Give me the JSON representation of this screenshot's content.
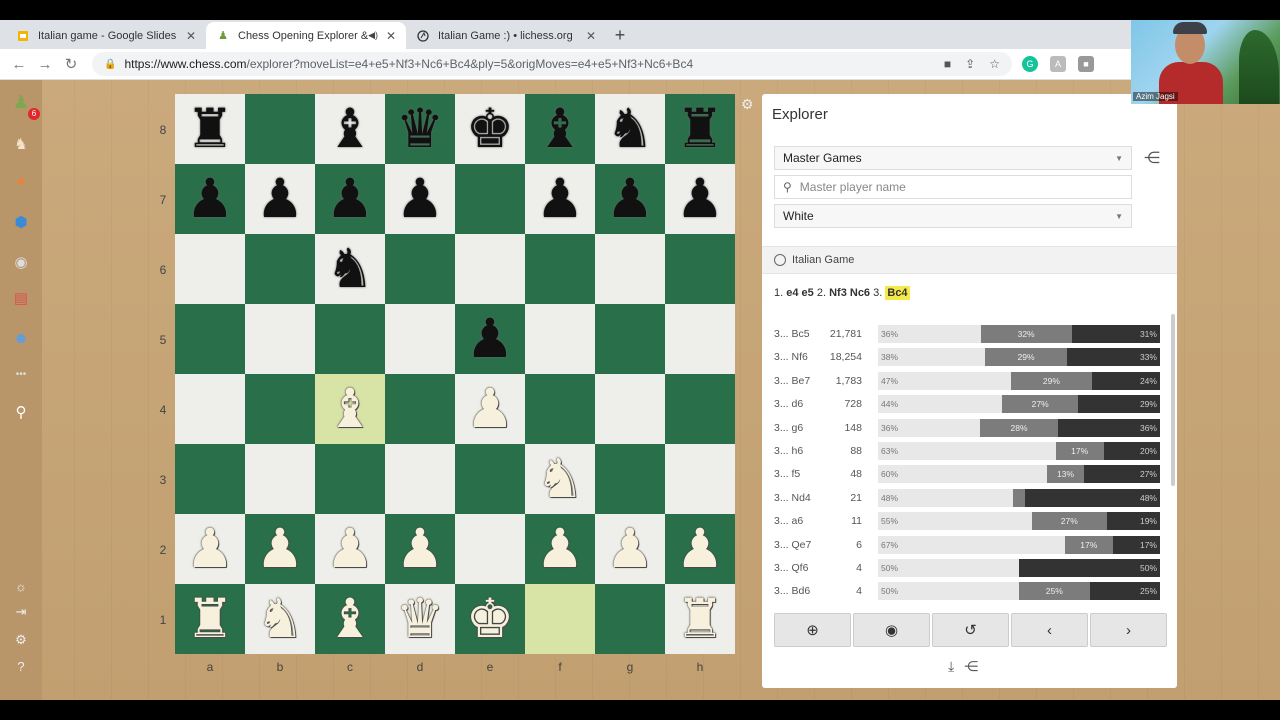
{
  "browser": {
    "tabs": [
      {
        "title": "Italian game - Google Slides",
        "icon": "slides-icon",
        "active": false
      },
      {
        "title": "Chess Opening Explorer & D",
        "icon": "chess-pawn-icon",
        "active": true
      },
      {
        "title": "Italian Game :) • lichess.org",
        "icon": "lichess-icon",
        "active": false
      }
    ],
    "url_host": "https://www.chess.com",
    "url_rest": "/explorer?moveList=e4+e5+Nf3+Nc6+Bc4&ply=5&origMoves=e4+e5+Nf3+Nc6+Bc4"
  },
  "sidebar": {
    "notification_count": "6",
    "icons": [
      "pawn-logo-icon",
      "play-icon",
      "puzzle-icon",
      "learn-icon",
      "watch-icon",
      "news-icon",
      "social-icon",
      "more-icon",
      "search-icon",
      "theme-icon",
      "collapse-icon",
      "settings-icon",
      "help-icon"
    ]
  },
  "board": {
    "ranks": [
      "8",
      "7",
      "6",
      "5",
      "4",
      "3",
      "2",
      "1"
    ],
    "files": [
      "a",
      "b",
      "c",
      "d",
      "e",
      "f",
      "g",
      "h"
    ],
    "pieces": [
      [
        "bR",
        "",
        "bB",
        "bQ",
        "bK",
        "bB",
        "bN",
        "bR"
      ],
      [
        "bP",
        "bP",
        "bP",
        "bP",
        "",
        "bP",
        "bP",
        "bP"
      ],
      [
        "",
        "",
        "bN",
        "",
        "",
        "",
        "",
        ""
      ],
      [
        "",
        "",
        "",
        "",
        "bP",
        "",
        "",
        ""
      ],
      [
        "",
        "",
        "wB",
        "",
        "wP",
        "",
        "",
        ""
      ],
      [
        "",
        "",
        "",
        "",
        "",
        "wN",
        "",
        ""
      ],
      [
        "wP",
        "wP",
        "wP",
        "wP",
        "",
        "wP",
        "wP",
        "wP"
      ],
      [
        "wR",
        "wN",
        "wB",
        "wQ",
        "wK",
        "",
        "",
        "wR"
      ]
    ],
    "last_move_squares": [
      "c4",
      "f1"
    ]
  },
  "explorer": {
    "title": "Explorer",
    "database": "Master Games",
    "player_placeholder": "Master player name",
    "color": "White",
    "opening_name": "Italian Game",
    "moves_line": [
      {
        "num": "1.",
        "moves": "e4 e5"
      },
      {
        "num": "2.",
        "moves": "Nf3 Nc6"
      },
      {
        "num": "3.",
        "moves": "Bc4"
      }
    ],
    "stats": [
      {
        "move": "3... Bc5",
        "games": "21,781",
        "white": 36,
        "draw": 32,
        "black": 31
      },
      {
        "move": "3... Nf6",
        "games": "18,254",
        "white": 38,
        "draw": 29,
        "black": 33
      },
      {
        "move": "3... Be7",
        "games": "1,783",
        "white": 47,
        "draw": 29,
        "black": 24
      },
      {
        "move": "3... d6",
        "games": "728",
        "white": 44,
        "draw": 27,
        "black": 29
      },
      {
        "move": "3... g6",
        "games": "148",
        "white": 36,
        "draw": 28,
        "black": 36
      },
      {
        "move": "3... h6",
        "games": "88",
        "white": 63,
        "draw": 17,
        "black": 20
      },
      {
        "move": "3... f5",
        "games": "48",
        "white": 60,
        "draw": 13,
        "black": 27
      },
      {
        "move": "3... Nd4",
        "games": "21",
        "white": 48,
        "draw": 4,
        "black": 48
      },
      {
        "move": "3... a6",
        "games": "11",
        "white": 55,
        "draw": 27,
        "black": 19
      },
      {
        "move": "3... Qe7",
        "games": "6",
        "white": 67,
        "draw": 17,
        "black": 17
      },
      {
        "move": "3... Qf6",
        "games": "4",
        "white": 50,
        "draw": 0,
        "black": 50
      },
      {
        "move": "3... Bd6",
        "games": "4",
        "white": 50,
        "draw": 25,
        "black": 25
      }
    ]
  },
  "webcam": {
    "name": "Azim Jagsi"
  }
}
